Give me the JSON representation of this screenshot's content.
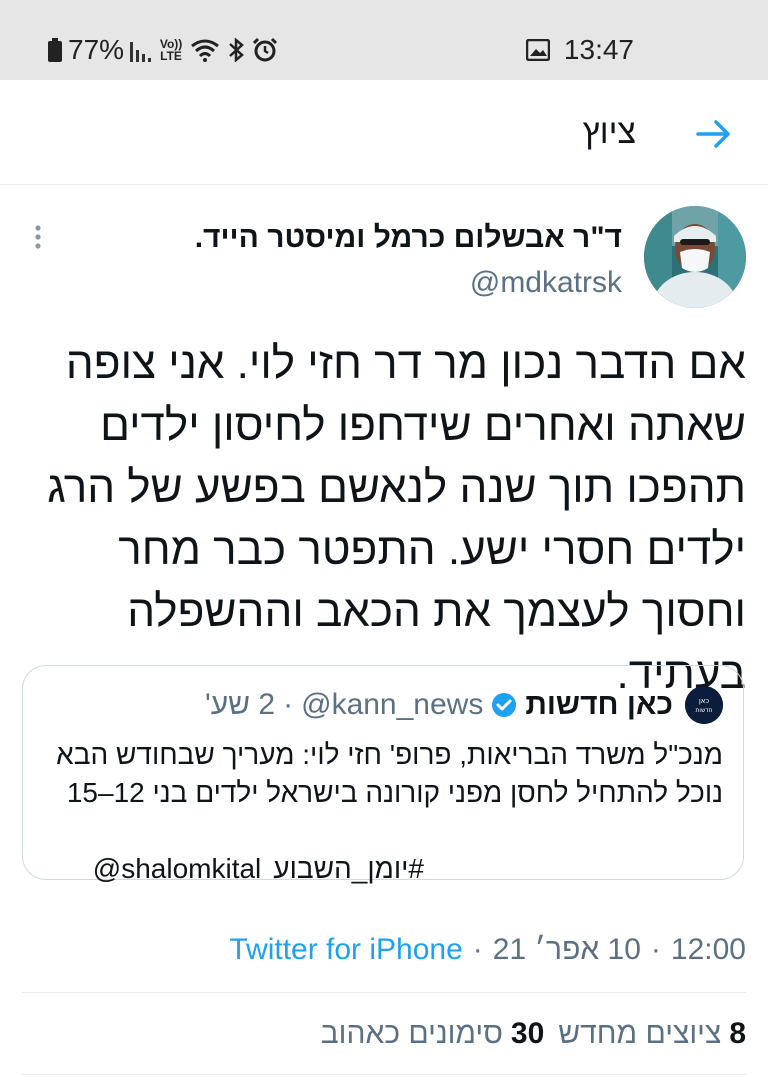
{
  "status_bar": {
    "battery": "77%",
    "time": "13:47",
    "volte_label": "Vo)) LTE"
  },
  "header": {
    "title": "ציוץ",
    "back_icon": "arrow-right-icon"
  },
  "tweet": {
    "author_name": "ד\"ר אבשלום כרמל ומיסטר הייד.",
    "author_handle": "@mdkatrsk",
    "text": "אם הדבר נכון מר דר חזי לוי. אני צופה שאתה ואחרים שידחפו לחיסון ילדים תהפכו תוך שנה לנאשם בפשע של הרג ילדים חסרי ישע. התפטר כבר מחר וחסוך לעצמך את הכאב וההשפלה בעתיד.",
    "quote": {
      "name": "כאן חדשות",
      "handle": "@kann_news",
      "dot": "·",
      "time": "2 שע'",
      "avatar_text": "כאן חדשות",
      "text": "מנכ\"ל משרד הבריאות, פרופ' חזי לוי: מעריך שבחודש הבא נוכל להתחיל לחסן מפני קורונה בישראל ילדים בני 12–15",
      "hashtag": "#יומן_השבוע",
      "mention": "@shalomkital"
    },
    "meta": {
      "time": "12:00",
      "date": "10 אפר׳ 21",
      "sep": "·",
      "source": "Twitter for iPhone"
    },
    "stats": {
      "retweets_count": "8",
      "retweets_label": "ציוצים מחדש",
      "likes_count": "30",
      "likes_label": "סימונים כאהוב"
    }
  },
  "colors": {
    "accent": "#1da1f2",
    "secondary_text": "#5b7083",
    "status_bar_bg": "#e6e6e6"
  }
}
